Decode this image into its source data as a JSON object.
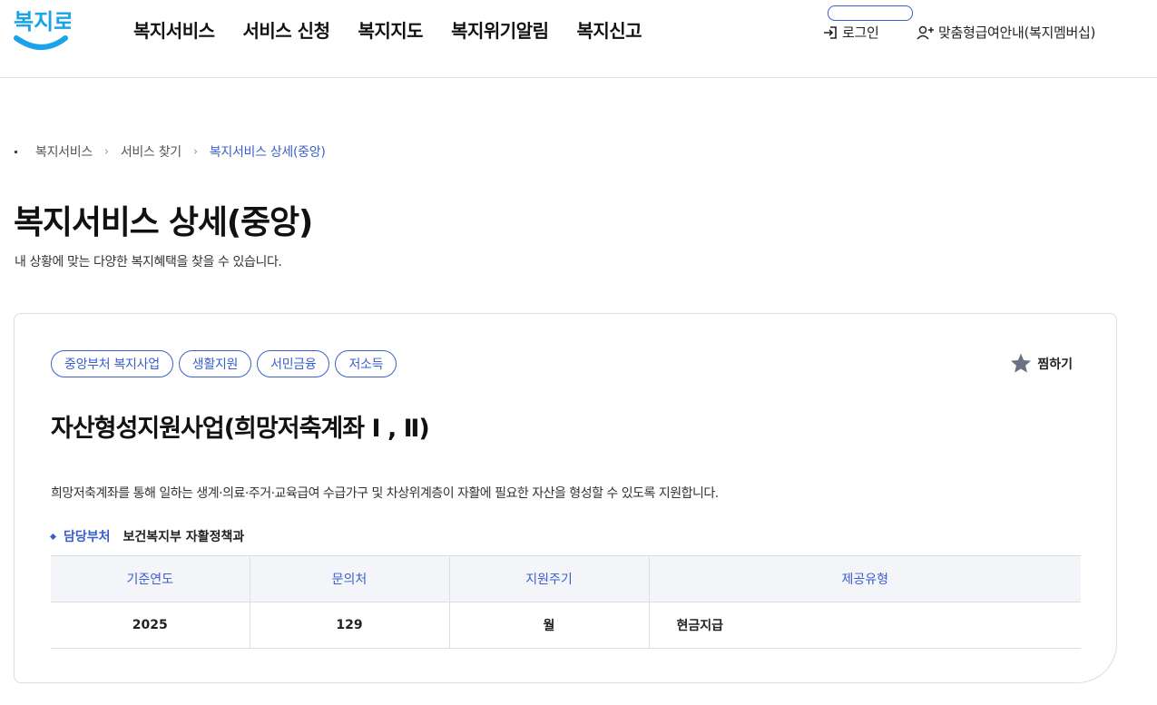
{
  "header": {
    "logo_text": "복지로",
    "nav": [
      "복지서비스",
      "서비스 신청",
      "복지지도",
      "복지위기알림",
      "복지신고"
    ],
    "login_label": "로그인",
    "member_label": "맞춤형급여안내(복지멤버십)"
  },
  "breadcrumb": [
    "복지서비스",
    "서비스 찾기",
    "복지서비스 상세(중앙)"
  ],
  "page": {
    "title": "복지서비스 상세(중앙)",
    "description": "내 상황에 맞는 다양한 복지혜택을 찾을 수 있습니다."
  },
  "service": {
    "tags": [
      "중앙부처 복지사업",
      "생활지원",
      "서민금융",
      "저소득"
    ],
    "bookmark_label": "찜하기",
    "title": "자산형성지원사업(희망저축계좌 Ⅰ , Ⅱ)",
    "description": "희망저축계좌를 통해 일하는 생계·의료·주거·교육급여 수급가구 및 차상위계층이 자활에 필요한 자산을 형성할 수 있도록 지원합니다.",
    "dept_label": "담당부처",
    "dept_value": "보건복지부 자활정책과",
    "table": {
      "headers": [
        "기준연도",
        "문의처",
        "지원주기",
        "제공유형"
      ],
      "row": [
        "2025",
        "129",
        "월",
        "현금지급"
      ]
    }
  },
  "colors": {
    "accent": "#3a5fcd",
    "logo_blue": "#1aa3e8",
    "header_bg": "#f3f5f9"
  }
}
